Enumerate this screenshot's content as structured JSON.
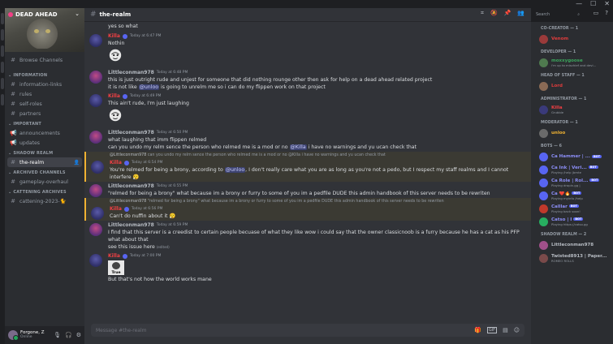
{
  "window": {
    "controls": [
      "—",
      "☐",
      "✕"
    ]
  },
  "server": {
    "name": "DEAD AHEAD"
  },
  "sidebar": {
    "browse": "Browse Channels",
    "categories": [
      {
        "name": "INFORMATION",
        "channels": [
          "information-links",
          "rules",
          "self-roles",
          "partners"
        ]
      },
      {
        "name": "IMPORTANT",
        "channels": [
          "announcements",
          "updates"
        ]
      },
      {
        "name": "SHADOW REALM",
        "channels": [
          "the-realm"
        ]
      },
      {
        "name": "ARCHIVED CHANNELS",
        "channels": [
          "gameplay-overhaul"
        ]
      },
      {
        "name": "CATTENING ARCHIVES",
        "channels": [
          "cattening-2023-🐈"
        ]
      }
    ]
  },
  "user": {
    "name": "Forgone, Z",
    "status": "Online"
  },
  "channel": {
    "name": "the-realm",
    "composer_placeholder": "Message #the-realm"
  },
  "search": {
    "placeholder": "Search"
  },
  "messages": {
    "top_line": "yes so what",
    "m1": {
      "author": "Killa",
      "time": "Today at 6:47 PM",
      "text": "Nothin"
    },
    "m2": {
      "author": "Littleconman978",
      "time": "Today at 6:48 PM",
      "line1": "this is just outright rude and unjest for someone that did nothing rounge other then ask for help on a dead ahead related project",
      "line2_a": "it is not like ",
      "line2_mention": "@unloo",
      "line2_b": " is going to unrelm me so i can do my flippen work on that project"
    },
    "m3": {
      "author": "Killa",
      "time": "Today at 6:49 PM",
      "text": "This ain't rude, I'm just laughing"
    },
    "m4": {
      "author": "Littleconman978",
      "time": "Today at 6:50 PM",
      "line1": "what laughing that imm flippen relmed",
      "line2_a": "can you undo my relm sence the person who relmed me is a mod or no ",
      "line2_mention": "@Killa",
      "line2_b": " i have no warnings and yu ucan check that"
    },
    "m5": {
      "reply_author": "@Littleconman978",
      "reply_text": "can you undo my relm sence the person who relmed me is a mod or no @Killa i have no warnings and yu ucan check that",
      "author": "Killa",
      "time": "Today at 6:54 PM",
      "text_a": "You're relmed for being a brony, according to ",
      "text_mention": "@unloo",
      "text_b": ", I don't really care what you are as long as you're not a pedo, but I respect my staff realms and I cannot interfere 😮‍💨"
    },
    "m6": {
      "author": "Littleconman978",
      "time": "Today at 6:55 PM",
      "text": "\"relmed for being a brony\" what because im a brony or furry to some of you im a pedfile DUDE this admin handbook of this server needs to be rewriten"
    },
    "m7": {
      "reply_author": "@Littleconman978",
      "reply_text": "\"relmed for being a brony\" what because im a brony or furry to some of you im a pedfile DUDE this admin handbook of this server needs to be rewriten",
      "author": "Killa",
      "time": "Today at 6:56 PM",
      "text": "Can't do nuffin about it 😮‍💨"
    },
    "m8": {
      "author": "Littleconman978",
      "time": "Today at 6:59 PM",
      "line1": "I find that this server is a creedist to certain people becuase of what they like wow i could say that the owner classicnoob is a furry because he has a cat as his PFP what about that",
      "line2": "see this issue here",
      "edited": "(edited)"
    },
    "m9": {
      "author": "Killa",
      "time": "Today at 7:00 PM",
      "img_caption": "True",
      "text": "But that's not how the world works mane"
    }
  },
  "members": {
    "groups": [
      {
        "title": "CO-CREATOR — 1",
        "items": [
          {
            "name": "Venom",
            "sub": "",
            "color": "#e03c3c"
          }
        ]
      },
      {
        "title": "DEVELOPER — 1",
        "items": [
          {
            "name": "moxxygoose",
            "sub": "i'm up to mischief and devi...",
            "color": "#3ba55c"
          }
        ]
      },
      {
        "title": "HEAD OF STAFF — 1",
        "items": [
          {
            "name": "Lord",
            "sub": "",
            "color": "#e03c3c"
          }
        ]
      },
      {
        "title": "ADMINISTRATOR — 1",
        "items": [
          {
            "name": "Killa",
            "sub": "Grubble",
            "color": "#f23f43"
          }
        ]
      },
      {
        "title": "MODERATOR — 1",
        "items": [
          {
            "name": "unloo",
            "sub": "",
            "color": "#f0b232"
          }
        ]
      },
      {
        "title": "BOTS — 6",
        "items": [
          {
            "name": "Ca Hammer | ...",
            "sub": "",
            "color": "#8b8df5",
            "bot": "BOT"
          },
          {
            "name": "Ca Ink | Veri...",
            "sub": "Playing /help |bmte",
            "color": "#8b8df5",
            "bot": "BOT"
          },
          {
            "name": "Ca Role | Rol...",
            "sub": "Playing dropin.gg |",
            "color": "#8b8df5",
            "bot": "BOT"
          },
          {
            "name": "Ca ❤️🔥",
            "sub": "Playing myinfo /help",
            "color": "#8b8df5",
            "bot": "BOT"
          },
          {
            "name": "Calllar",
            "sub": "Playing back soon!",
            "color": "#8b8df5",
            "bot": "BOT"
          },
          {
            "name": "Catso | I",
            "sub": "Playing https://catso.gg",
            "color": "#8b8df5",
            "bot": "BOT"
          }
        ]
      },
      {
        "title": "SHADOW REALM — 2",
        "items": [
          {
            "name": "Littleconman978",
            "sub": "",
            "color": "#b5bac1"
          },
          {
            "name": "Twisted8913 | Paper...",
            "sub": "ROMEO ROLLS",
            "color": "#b5bac1"
          }
        ]
      }
    ]
  }
}
